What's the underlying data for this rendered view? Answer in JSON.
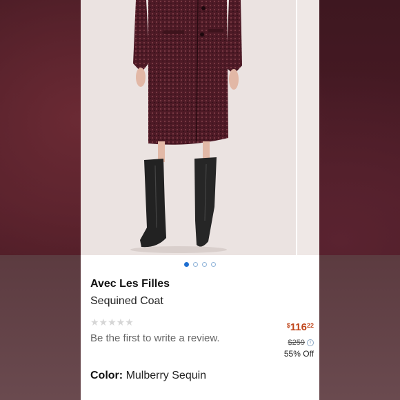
{
  "product": {
    "brand": "Avec Les Filles",
    "name": "Sequined Coat",
    "rating_stars": "★★★★★",
    "review_prompt": "Be the first to write a review.",
    "price_symbol": "$",
    "price_whole": "116",
    "price_cents": "22",
    "original_price": "$259",
    "discount": "55% Off",
    "color_label": "Color:",
    "color_value": "Mulberry Sequin"
  },
  "gallery": {
    "pages": 4,
    "active_index": 0
  },
  "colors": {
    "price": "#c0461b",
    "pager_active": "#1f6fd1",
    "coat": "#4e1a26"
  }
}
